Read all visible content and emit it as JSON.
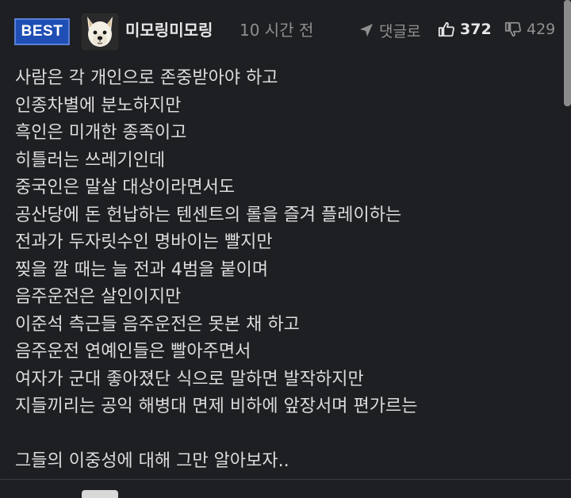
{
  "comment": {
    "badge": "BEST",
    "username": "미모링미모링",
    "time": "10 시간 전",
    "reply_label": "댓글로",
    "like_count": "372",
    "dislike_count": "429",
    "lines": [
      "사람은 각 개인으로 존중받아야 하고",
      "인종차별에 분노하지만",
      "흑인은 미개한 종족이고",
      "히틀러는 쓰레기인데",
      "중국인은 말살 대상이라면서도",
      "공산당에 돈 헌납하는 텐센트의 롤을 즐겨 플레이하는",
      "전과가 두자릿수인 명바이는 빨지만",
      "찢을 깔 때는 늘 전과 4범을 붙이며",
      "음주운전은 살인이지만",
      "이준석 측근들 음주운전은 못본 채 하고",
      "음주운전 연예인들은 빨아주면서",
      "여자가 군대 좋아졌단 식으로 말하면 발작하지만",
      "지들끼리는 공익 해병대 면제 비하에 앞장서며 편가르는"
    ],
    "closing_line": "그들의 이중성에 대해 그만 알아보자.."
  },
  "icons": {
    "reply": "reply-arrow-icon",
    "like": "thumbs-up-icon",
    "dislike": "thumbs-down-icon",
    "avatar": "dog-avatar"
  },
  "colors": {
    "background": "#1e1f22",
    "badge": "#1f4fb4",
    "text": "#dcdcdc",
    "muted": "#8f8f8f"
  }
}
